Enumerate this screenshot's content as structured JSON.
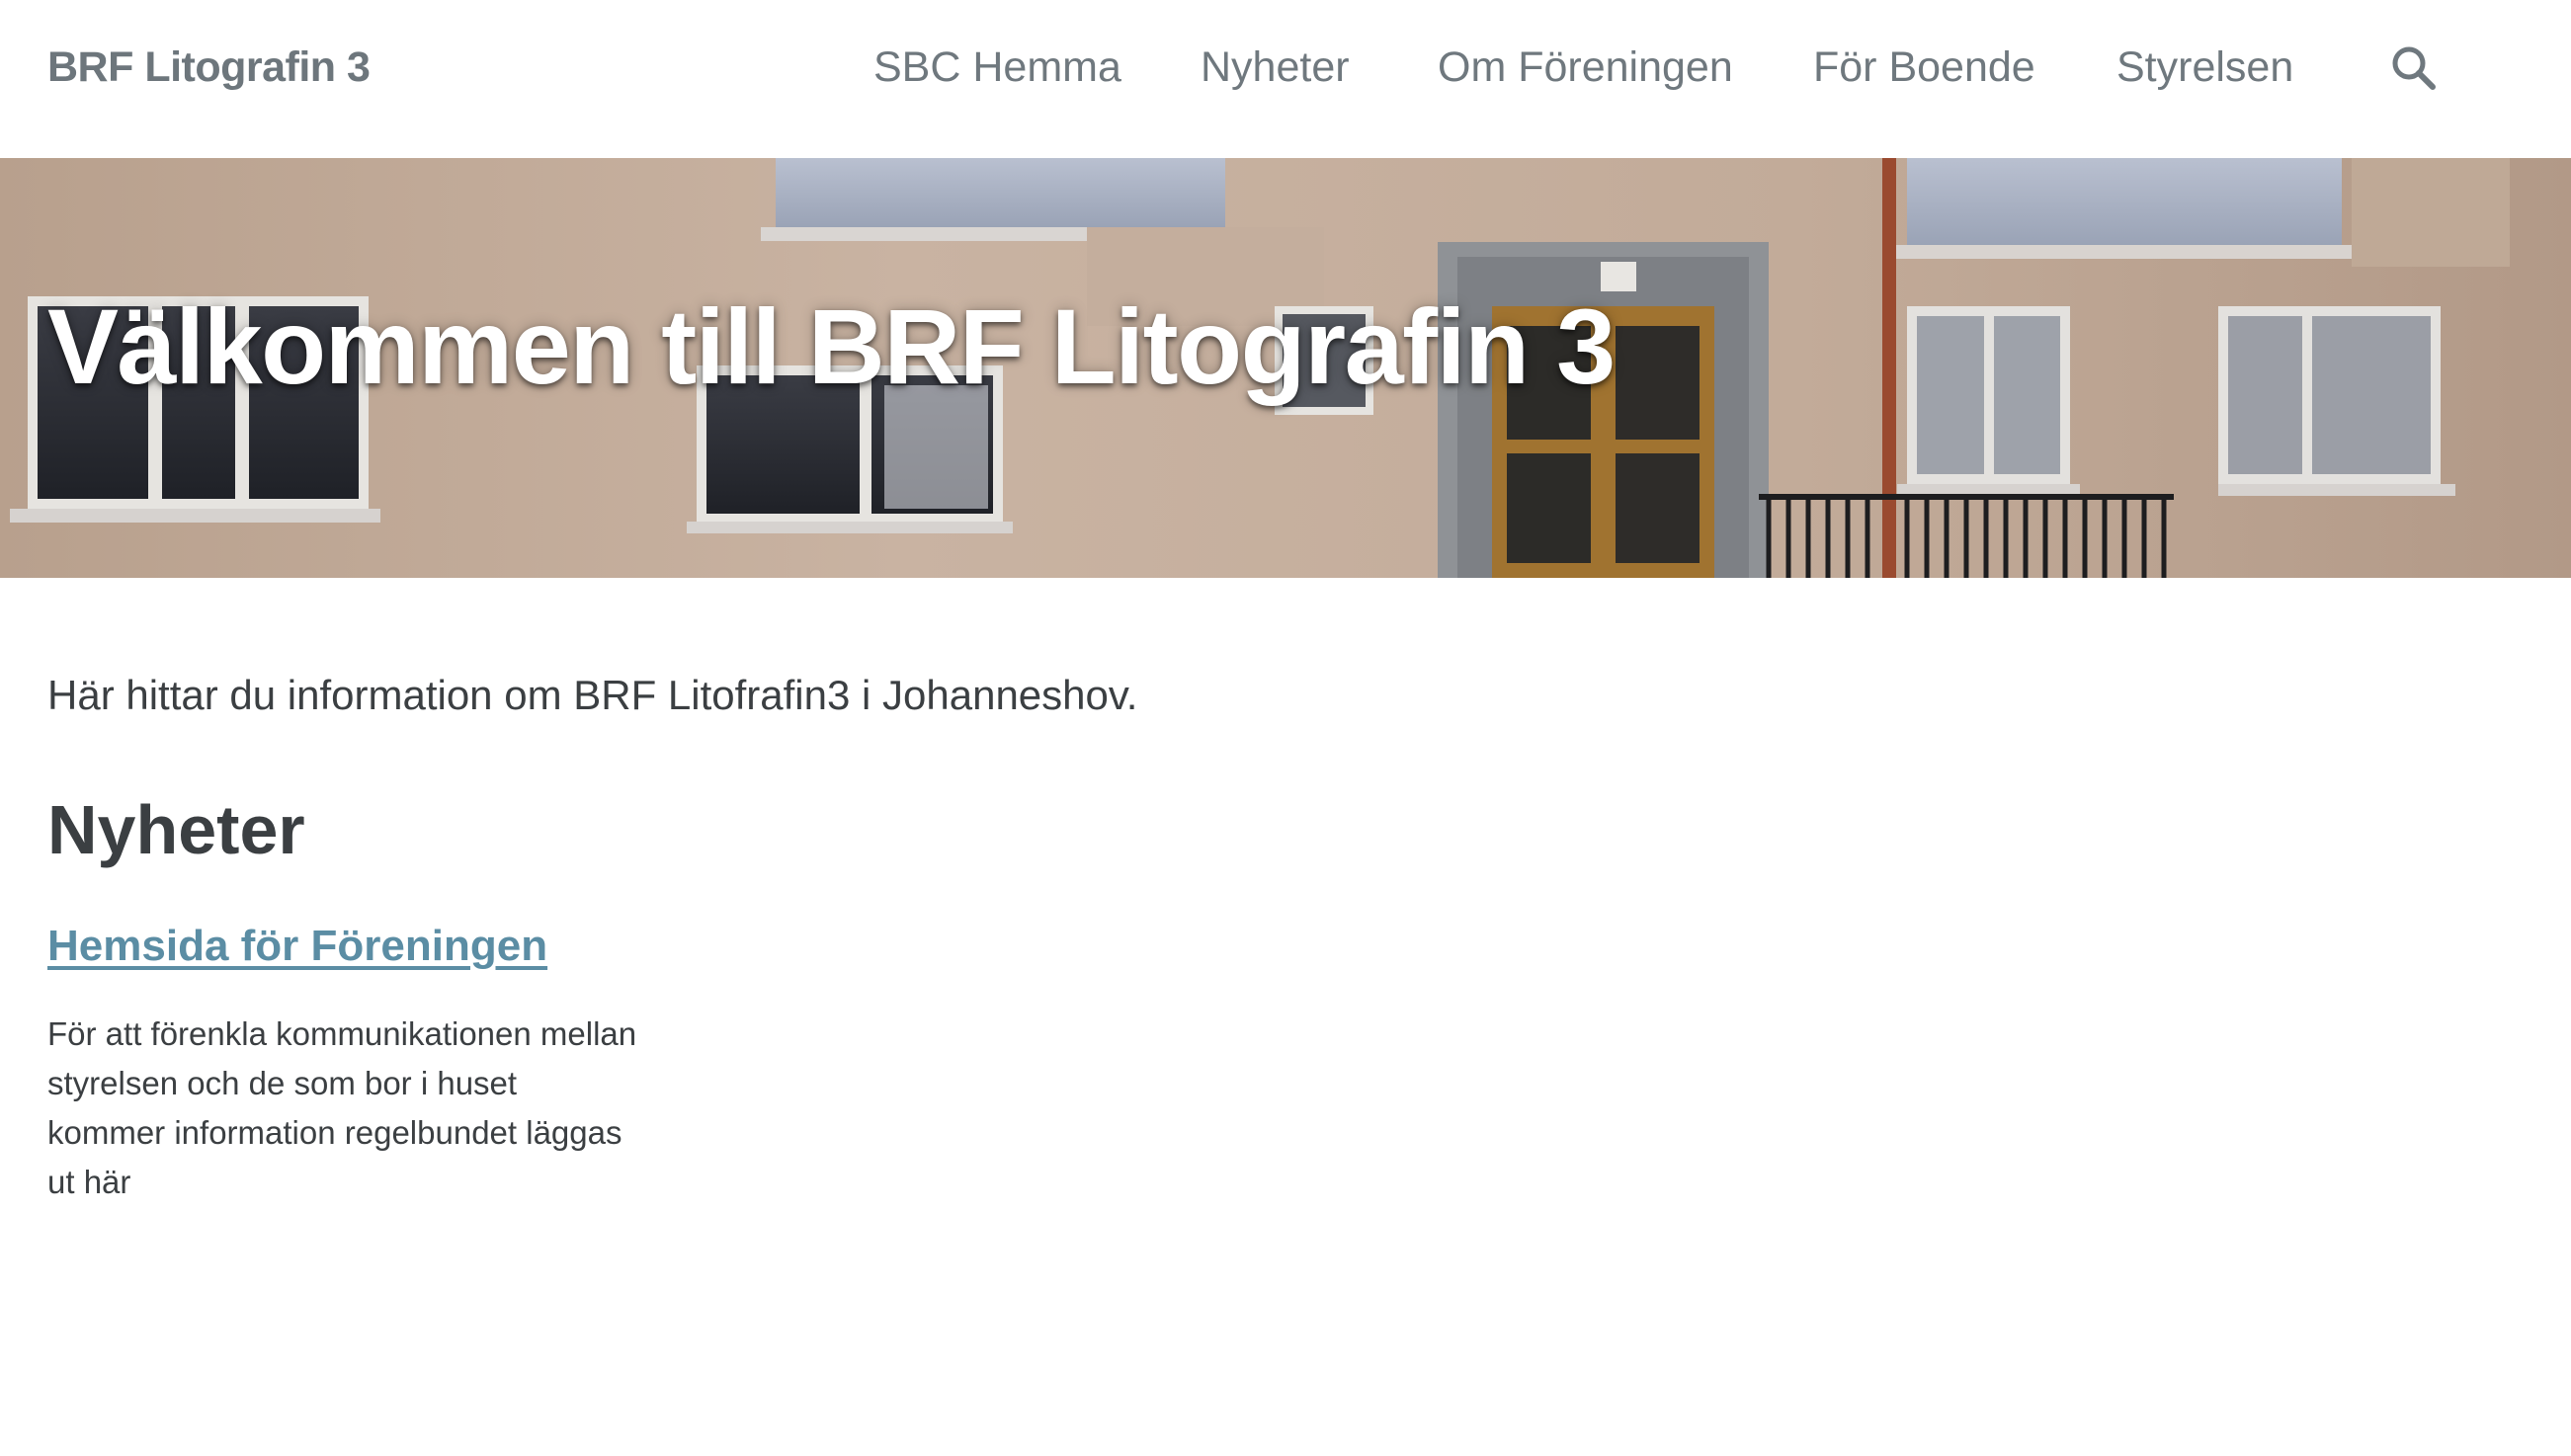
{
  "header": {
    "site_title": "BRF Litografin 3",
    "nav": [
      "SBC Hemma",
      "Nyheter",
      "Om Föreningen",
      "För Boende",
      "Styrelsen"
    ],
    "search_icon": "search-icon"
  },
  "hero": {
    "title": "Välkommen till BRF Litografin 3"
  },
  "main": {
    "intro": "Här hittar du information om BRF Litofrafin3 i Johanneshov.",
    "section_title": "Nyheter",
    "posts": [
      {
        "title": "Hemsida för Föreningen",
        "excerpt": "För att förenkla kommunikationen mellan styrelsen och de som bor i huset kommer information regelbundet läggas ut här"
      }
    ]
  },
  "colors": {
    "link": "#5b8da4",
    "nav_text": "#6f787e",
    "body_text": "#3b3f42"
  }
}
